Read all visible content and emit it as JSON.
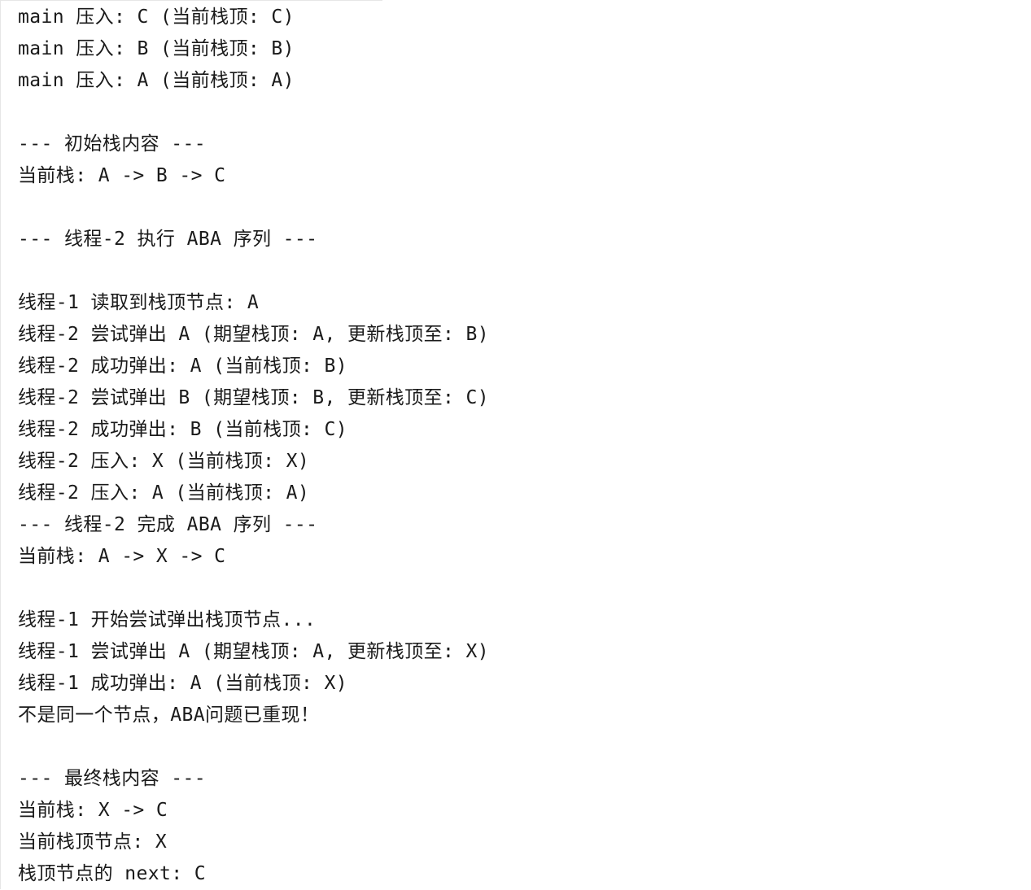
{
  "console": {
    "lines": [
      "main 压入: C (当前栈顶: C)",
      "main 压入: B (当前栈顶: B)",
      "main 压入: A (当前栈顶: A)",
      "",
      "--- 初始栈内容 ---",
      "当前栈: A -> B -> C",
      "",
      "--- 线程-2 执行 ABA 序列 ---",
      "",
      "线程-1 读取到栈顶节点: A",
      "线程-2 尝试弹出 A (期望栈顶: A, 更新栈顶至: B)",
      "线程-2 成功弹出: A (当前栈顶: B)",
      "线程-2 尝试弹出 B (期望栈顶: B, 更新栈顶至: C)",
      "线程-2 成功弹出: B (当前栈顶: C)",
      "线程-2 压入: X (当前栈顶: X)",
      "线程-2 压入: A (当前栈顶: A)",
      "--- 线程-2 完成 ABA 序列 ---",
      "当前栈: A -> X -> C",
      "",
      "线程-1 开始尝试弹出栈顶节点...",
      "线程-1 尝试弹出 A (期望栈顶: A, 更新栈顶至: X)",
      "线程-1 成功弹出: A (当前栈顶: X)",
      "不是同一个节点，ABA问题已重现！",
      "",
      "--- 最终栈内容 ---",
      "当前栈: X -> C",
      "当前栈顶节点: X",
      "栈顶节点的 next: C"
    ]
  }
}
